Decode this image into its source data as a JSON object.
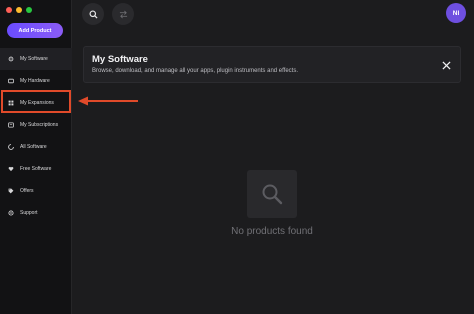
{
  "sidebar": {
    "add_product_label": "Add Product",
    "items": [
      {
        "label": "My Software",
        "icon": "software-icon",
        "active": true
      },
      {
        "label": "My Hardware",
        "icon": "hardware-icon"
      },
      {
        "label": "My Expansions",
        "icon": "grid-icon"
      },
      {
        "label": "My Subscriptions",
        "icon": "subscriptions-icon"
      },
      {
        "label": "All Software",
        "icon": "all-software-icon"
      },
      {
        "label": "Free Software",
        "icon": "heart-icon"
      },
      {
        "label": "Offers",
        "icon": "tag-icon"
      },
      {
        "label": "Support",
        "icon": "support-icon"
      }
    ]
  },
  "header": {
    "avatar_initials": "NI"
  },
  "banner": {
    "title": "My Software",
    "subtitle": "Browse, download, and manage all your apps, plugin instruments and effects."
  },
  "main": {
    "empty_state": "No products found"
  },
  "colors": {
    "accent": "#6a4cff",
    "highlight": "#e04a2a",
    "avatar": "#6e4fe0"
  }
}
